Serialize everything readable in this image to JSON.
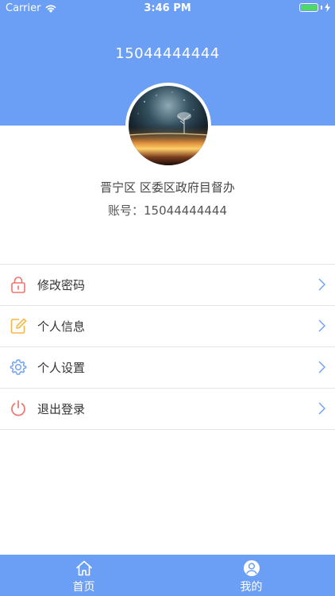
{
  "status_bar": {
    "carrier": "Carrier",
    "time": "3:46 PM",
    "battery_level": 1.0
  },
  "header": {
    "phone_title": "15044444444"
  },
  "profile": {
    "org_name": "晋宁区 区委区政府目督办",
    "account_label": "账号：",
    "account_value": "15044444444"
  },
  "menu": {
    "items": [
      {
        "label": "修改密码",
        "icon": "lock-icon",
        "color": "#f0736e"
      },
      {
        "label": "个人信息",
        "icon": "edit-icon",
        "color": "#f5b845"
      },
      {
        "label": "个人设置",
        "icon": "gear-icon",
        "color": "#6a9ff5"
      },
      {
        "label": "退出登录",
        "icon": "power-icon",
        "color": "#f0736e"
      }
    ]
  },
  "tabbar": {
    "tabs": [
      {
        "label": "首页",
        "icon": "home-icon"
      },
      {
        "label": "我的",
        "icon": "user-icon"
      }
    ]
  },
  "colors": {
    "primary": "#6a9ff5",
    "chevron": "#6a9ff5"
  }
}
